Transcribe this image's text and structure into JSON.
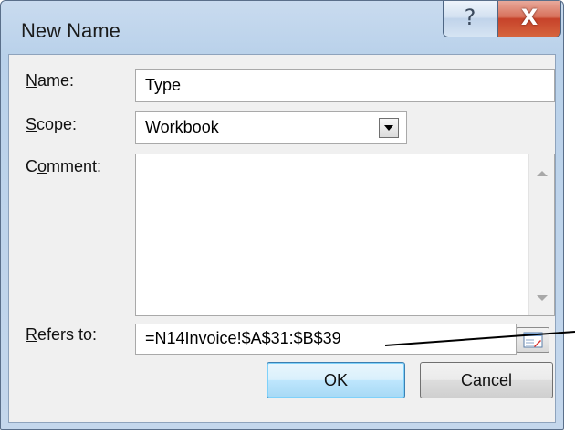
{
  "window": {
    "title": "New Name",
    "help_glyph": "?",
    "close_glyph": "X"
  },
  "form": {
    "name_label_first": "N",
    "name_label_rest": "ame:",
    "name_value": "Type",
    "scope_label_first": "S",
    "scope_label_rest": "cope:",
    "scope_value": "Workbook",
    "comment_label_first": "C",
    "comment_label_mid": "o",
    "comment_label_rest": "mment:",
    "comment_value": "",
    "refers_label_first": "R",
    "refers_label_rest": "efers to:",
    "refers_value": "=N14Invoice!$A$31:$B$39"
  },
  "buttons": {
    "ok_label": "OK",
    "cancel_label": "Cancel"
  },
  "icons": {
    "help": "help-icon",
    "close": "close-icon",
    "dropdown": "chevron-down-icon",
    "collapse": "collapse-dialog-icon",
    "scroll_up": "scroll-up-icon",
    "scroll_down": "scroll-down-icon"
  },
  "colors": {
    "title_bar": "#b9d1ea",
    "close_button": "#c6422a",
    "ok_button_border": "#3c7fb1",
    "client_background": "#f0f0f0"
  }
}
